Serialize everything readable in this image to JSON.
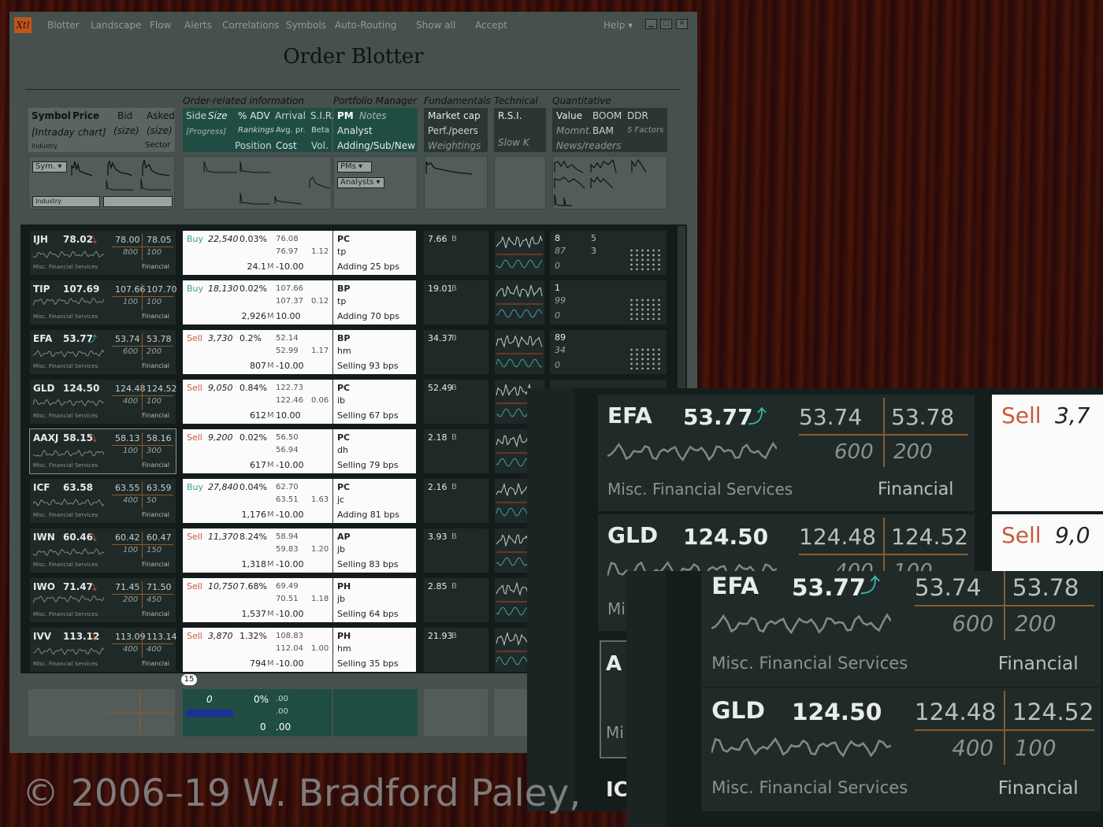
{
  "app": {
    "logo": "Xtl",
    "title": "Order Blotter"
  },
  "menu": [
    "Blotter",
    "Landscape",
    "Flow",
    "Alerts",
    "Correlations",
    "Symbols",
    "Auto-Routing",
    "Show all",
    "Accept"
  ],
  "help": "Help ▾",
  "groups": {
    "order": "Order-related information",
    "pm": "Portfolio Manager",
    "fund": "Fundamentals",
    "tech": "Technical",
    "quant": "Quantitative"
  },
  "headers": {
    "symbol": "Symbol",
    "price": "Price",
    "bid": "Bid",
    "asked": "Asked",
    "intraday": "[Intraday chart]",
    "size": "(size)",
    "industry": "Industry",
    "sector": "Sector",
    "side": "Side",
    "sizeH": "Size",
    "adv": "% ADV",
    "arrival": "Arrival",
    "sir": "S.I.R.",
    "progress": "[Progress]",
    "rankings": "Rankings",
    "avgpr": "Avg. pr.",
    "beta": "Beta",
    "position": "Position",
    "cost": "Cost",
    "vol": "Vol.",
    "pm": "PM",
    "notes": "Notes",
    "analyst": "Analyst",
    "adding": "Adding/Sub/New",
    "mcap": "Market cap",
    "perf": "Perf./peers",
    "weightings": "Weightings",
    "rsi": "R.S.I.",
    "slowk": "Slow K",
    "value": "Value",
    "boom": "BOOM",
    "ddr": "DDR",
    "momnt": "Momnt.",
    "bam": "BAM",
    "factors": "5 Factors",
    "news": "News/readers"
  },
  "filters": {
    "sym": "Sym.",
    "industry": "Industry",
    "pms": "PMs",
    "analysts": "Analysts"
  },
  "rows": [
    {
      "sym": "IJH",
      "price": "78.02",
      "arrow": "down",
      "bid": "78.00",
      "ask": "78.05",
      "bsz": "800",
      "asz": "100",
      "ind": "Misc. Financial Services",
      "sec": "Financial",
      "side": "Buy",
      "size": "22,540",
      "adv": "0.03%",
      "a1": "76.08",
      "a2": "76.97",
      "beta": "1.12",
      "pos": "24.1",
      "cost": "-10.00",
      "pm": "PC",
      "an": "tp",
      "act": "Adding 25 bps",
      "mcap": "7.66",
      "q1": "8",
      "q2": "5",
      "q3": "87",
      "q4": "3",
      "q5": "0"
    },
    {
      "sym": "TIP",
      "price": "107.69",
      "arrow": "",
      "bid": "107.66",
      "ask": "107.70",
      "bsz": "100",
      "asz": "100",
      "ind": "Misc. Financial Services",
      "sec": "Financial",
      "side": "Buy",
      "size": "18,130",
      "adv": "0.02%",
      "a1": "107.66",
      "a2": "107.37",
      "beta": "0.12",
      "pos": "2,926",
      "cost": "10.00",
      "pm": "BP",
      "an": "tp",
      "act": "Adding 70 bps",
      "mcap": "19.01",
      "q1": "1",
      "q2": "",
      "q3": "99",
      "q4": "",
      "q5": "0"
    },
    {
      "sym": "EFA",
      "price": "53.77",
      "arrow": "up",
      "bid": "53.74",
      "ask": "53.78",
      "bsz": "600",
      "asz": "200",
      "ind": "Misc. Financial Services",
      "sec": "Financial",
      "side": "Sell",
      "size": "3,730",
      "adv": "0.2%",
      "a1": "52.14",
      "a2": "52.99",
      "beta": "1.17",
      "pos": "807",
      "cost": "-10.00",
      "pm": "BP",
      "an": "hm",
      "act": "Selling 93 bps",
      "mcap": "34.37",
      "q1": "89",
      "q2": "",
      "q3": "34",
      "q4": "",
      "q5": "0"
    },
    {
      "sym": "GLD",
      "price": "124.50",
      "arrow": "",
      "bid": "124.48",
      "ask": "124.52",
      "bsz": "400",
      "asz": "100",
      "ind": "Misc. Financial Services",
      "sec": "Financial",
      "side": "Sell",
      "size": "9,050",
      "adv": "0.84%",
      "a1": "122.73",
      "a2": "122.46",
      "beta": "0.06",
      "pos": "612",
      "cost": "10.00",
      "pm": "PC",
      "an": "ib",
      "act": "Selling 67 bps",
      "mcap": "52.49",
      "q1": "",
      "q2": "",
      "q3": "",
      "q4": "",
      "q5": ""
    },
    {
      "sym": "AAXJ",
      "price": "58.15",
      "arrow": "down",
      "bid": "58.13",
      "ask": "58.16",
      "bsz": "100",
      "asz": "300",
      "ind": "Misc. Financial Services",
      "sec": "Financial",
      "side": "Sell",
      "size": "9,200",
      "adv": "0.02%",
      "a1": "56.50",
      "a2": "56.94",
      "beta": "",
      "pos": "617",
      "cost": "-10.00",
      "pm": "PC",
      "an": "dh",
      "act": "Selling 79 bps",
      "mcap": "2.18",
      "q1": "",
      "q2": "",
      "q3": "",
      "q4": "",
      "q5": ""
    },
    {
      "sym": "ICF",
      "price": "63.58",
      "arrow": "",
      "bid": "63.55",
      "ask": "63.59",
      "bsz": "400",
      "asz": "50",
      "ind": "Misc. Financial Services",
      "sec": "Financial",
      "side": "Buy",
      "size": "27,840",
      "adv": "0.04%",
      "a1": "62.70",
      "a2": "63.51",
      "beta": "1.63",
      "pos": "1,176",
      "cost": "-10.00",
      "pm": "PC",
      "an": "jc",
      "act": "Adding 81 bps",
      "mcap": "2.16",
      "q1": "",
      "q2": "",
      "q3": "",
      "q4": "",
      "q5": ""
    },
    {
      "sym": "IWN",
      "price": "60.46",
      "arrow": "down",
      "bid": "60.42",
      "ask": "60.47",
      "bsz": "100",
      "asz": "150",
      "ind": "Misc. Financial Services",
      "sec": "Financial",
      "side": "Sell",
      "size": "11,370",
      "adv": "8.24%",
      "a1": "58.94",
      "a2": "59.83",
      "beta": "1.20",
      "pos": "1,318",
      "cost": "-10.00",
      "pm": "AP",
      "an": "jb",
      "act": "Selling 83 bps",
      "mcap": "3.93",
      "q1": "",
      "q2": "",
      "q3": "",
      "q4": "",
      "q5": ""
    },
    {
      "sym": "IWO",
      "price": "71.47",
      "arrow": "down",
      "bid": "71.45",
      "ask": "71.50",
      "bsz": "200",
      "asz": "450",
      "ind": "Misc. Financial Services",
      "sec": "Financial",
      "side": "Sell",
      "size": "10,750",
      "adv": "7.68%",
      "a1": "69.49",
      "a2": "70.51",
      "beta": "1.18",
      "pos": "1,537",
      "cost": "-10.00",
      "pm": "PH",
      "an": "jb",
      "act": "Selling 64 bps",
      "mcap": "2.85",
      "q1": "",
      "q2": "",
      "q3": "",
      "q4": "",
      "q5": ""
    },
    {
      "sym": "IVV",
      "price": "113.12",
      "arrow": "down",
      "bid": "113.09",
      "ask": "113.14",
      "bsz": "400",
      "asz": "400",
      "ind": "Misc. Financial Services",
      "sec": "Financial",
      "side": "Sell",
      "size": "3,870",
      "adv": "1.32%",
      "a1": "108.83",
      "a2": "112.04",
      "beta": "1.00",
      "pos": "794",
      "cost": "-10.00",
      "pm": "PH",
      "an": "hm",
      "act": "Selling 35 bps",
      "mcap": "21.93",
      "q1": "",
      "q2": "",
      "q3": "",
      "q4": "",
      "q5": ""
    }
  ],
  "units": {
    "million": "M",
    "billion": "B"
  },
  "count": "15",
  "totals": {
    "size": "0",
    "pct": "0%",
    "v1": ".00",
    "v2": ".00",
    "pos": "0",
    "v3": ".00"
  },
  "zoom_rows": [
    {
      "sym": "EFA",
      "price": "53.77",
      "bid": "53.74",
      "ask": "53.78",
      "bsz": "600",
      "asz": "200",
      "ind": "Misc. Financial Services",
      "sec": "Financial",
      "side": "Sell",
      "size": "3,7"
    },
    {
      "sym": "GLD",
      "price": "124.50",
      "bid": "124.48",
      "ask": "124.52",
      "bsz": "400",
      "asz": "100",
      "ind": "Misc. Financial Services",
      "sec": "Financial",
      "side": "Sell",
      "size": "9,0"
    }
  ],
  "zoom_peek": {
    "a": "A",
    "ic": "IC",
    "mi": "Mi"
  },
  "watermark": "© 2006–19  W. Bradford Paley,"
}
